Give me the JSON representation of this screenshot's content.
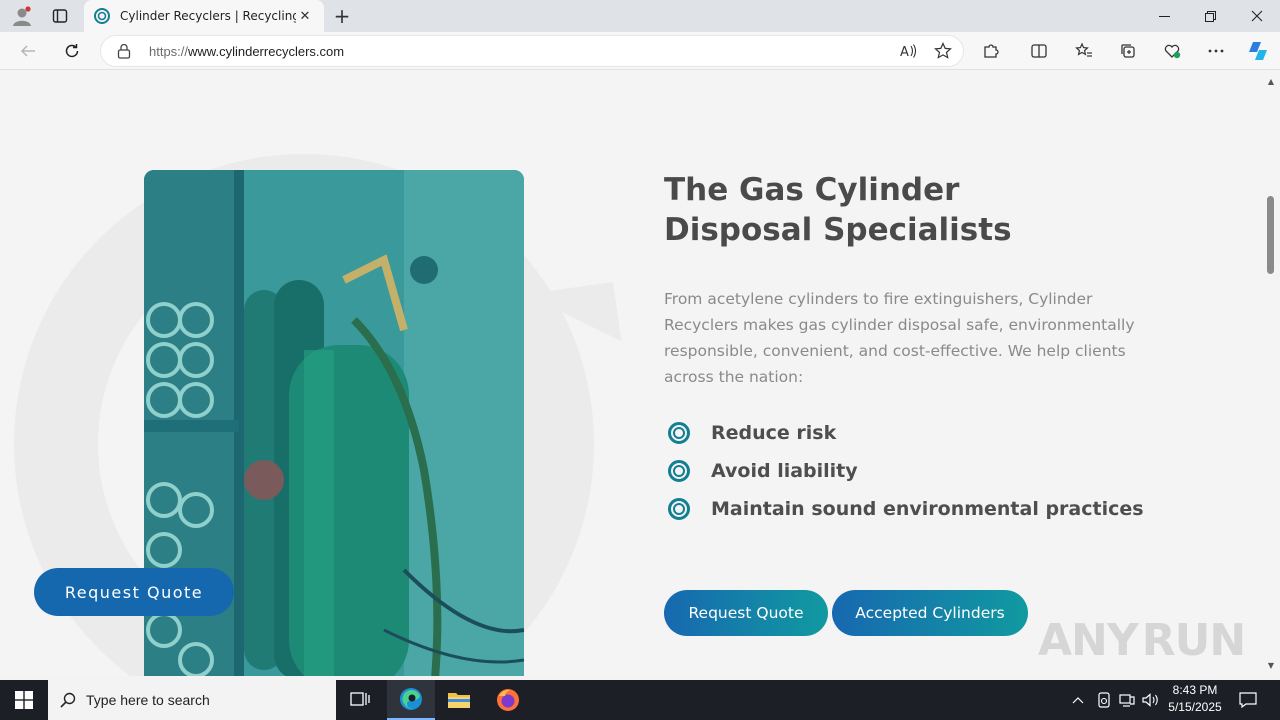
{
  "browser": {
    "tab_title": "Cylinder Recyclers | Recycling | D",
    "url_host": "https://www.cylinderrecyclers.com",
    "url_prefix": "https://",
    "url_rest": "www.cylinderrecyclers.com"
  },
  "page": {
    "heading_line1": "The Gas Cylinder",
    "heading_line2": "Disposal Specialists",
    "intro": "From acetylene cylinders to fire extinguishers, Cylinder Recyclers makes gas cylinder disposal safe, environmentally responsible, convenient, and cost-effective. We help clients across the nation:",
    "benefits": [
      "Reduce risk",
      "Avoid liability",
      "Maintain sound environmental practices"
    ],
    "button_quote": "Request Quote",
    "button_cylinders": "Accepted Cylinders",
    "float_button": "Request Quote",
    "accent_color": "#137f92",
    "button_gradient": [
      "#1768b0",
      "#119aa0"
    ]
  },
  "watermark": {
    "left": "ANY",
    "right": "RUN"
  },
  "taskbar": {
    "search_placeholder": "Type here to search",
    "time": "8:43 PM",
    "date": "5/15/2025"
  }
}
